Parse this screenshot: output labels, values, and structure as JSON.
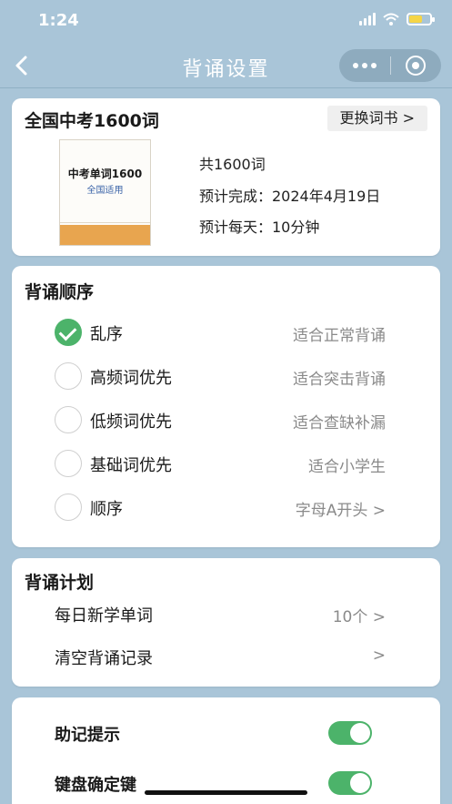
{
  "status": {
    "time": "1:24"
  },
  "nav": {
    "title": "背诵设置"
  },
  "book": {
    "name": "全国中考1600词",
    "change_label": "更换词书 >",
    "cover_title": "中考单词1600",
    "cover_subtitle": "全国适用",
    "total": "共1600词",
    "finish": "预计完成：2024年4月19日",
    "daily_time": "预计每天：10分钟"
  },
  "order": {
    "title": "背诵顺序",
    "options": [
      {
        "label": "乱序",
        "desc": "适合正常背诵",
        "checked": true
      },
      {
        "label": "高频词优先",
        "desc": "适合突击背诵",
        "checked": false
      },
      {
        "label": "低频词优先",
        "desc": "适合查缺补漏",
        "checked": false
      },
      {
        "label": "基础词优先",
        "desc": "适合小学生",
        "checked": false
      },
      {
        "label": "顺序",
        "desc": "字母A开头 >",
        "checked": false
      }
    ]
  },
  "plan": {
    "title": "背诵计划",
    "daily_new_label": "每日新学单词",
    "daily_new_value": "10个 >",
    "clear_label": "清空背诵记录",
    "clear_value": ">"
  },
  "toggles": {
    "mnemonic_label": "助记提示",
    "mnemonic_on": true,
    "enter_key_label": "键盘确定键",
    "enter_key_on": true
  },
  "colors": {
    "accent": "#4cb36a",
    "background": "#a9c5d8"
  }
}
